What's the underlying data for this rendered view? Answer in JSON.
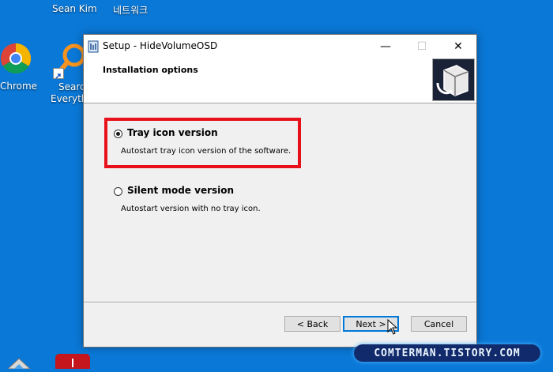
{
  "desktop": {
    "user_label": "Sean Kim",
    "network_label": "네트워크",
    "chrome_label": "Chrome",
    "search_label_line1": "Search",
    "search_label_line2": "Everythi"
  },
  "window": {
    "title": "Setup - HideVolumeOSD",
    "minimize_glyph": "—",
    "maximize_glyph": "☐",
    "close_glyph": "✕"
  },
  "header": {
    "title": "Installation options"
  },
  "options": [
    {
      "label": "Tray icon version",
      "description": "Autostart tray icon version of the software.",
      "selected": true
    },
    {
      "label": "Silent mode version",
      "description": "Autostart version with no tray icon.",
      "selected": false
    }
  ],
  "buttons": {
    "back": "< Back",
    "next": "Next >",
    "cancel": "Cancel"
  },
  "watermark": "COMTERMAN.TISTORY.COM",
  "colors": {
    "desktop": "#0a78d7",
    "highlight": "#e8101b",
    "accent": "#0078d7"
  }
}
